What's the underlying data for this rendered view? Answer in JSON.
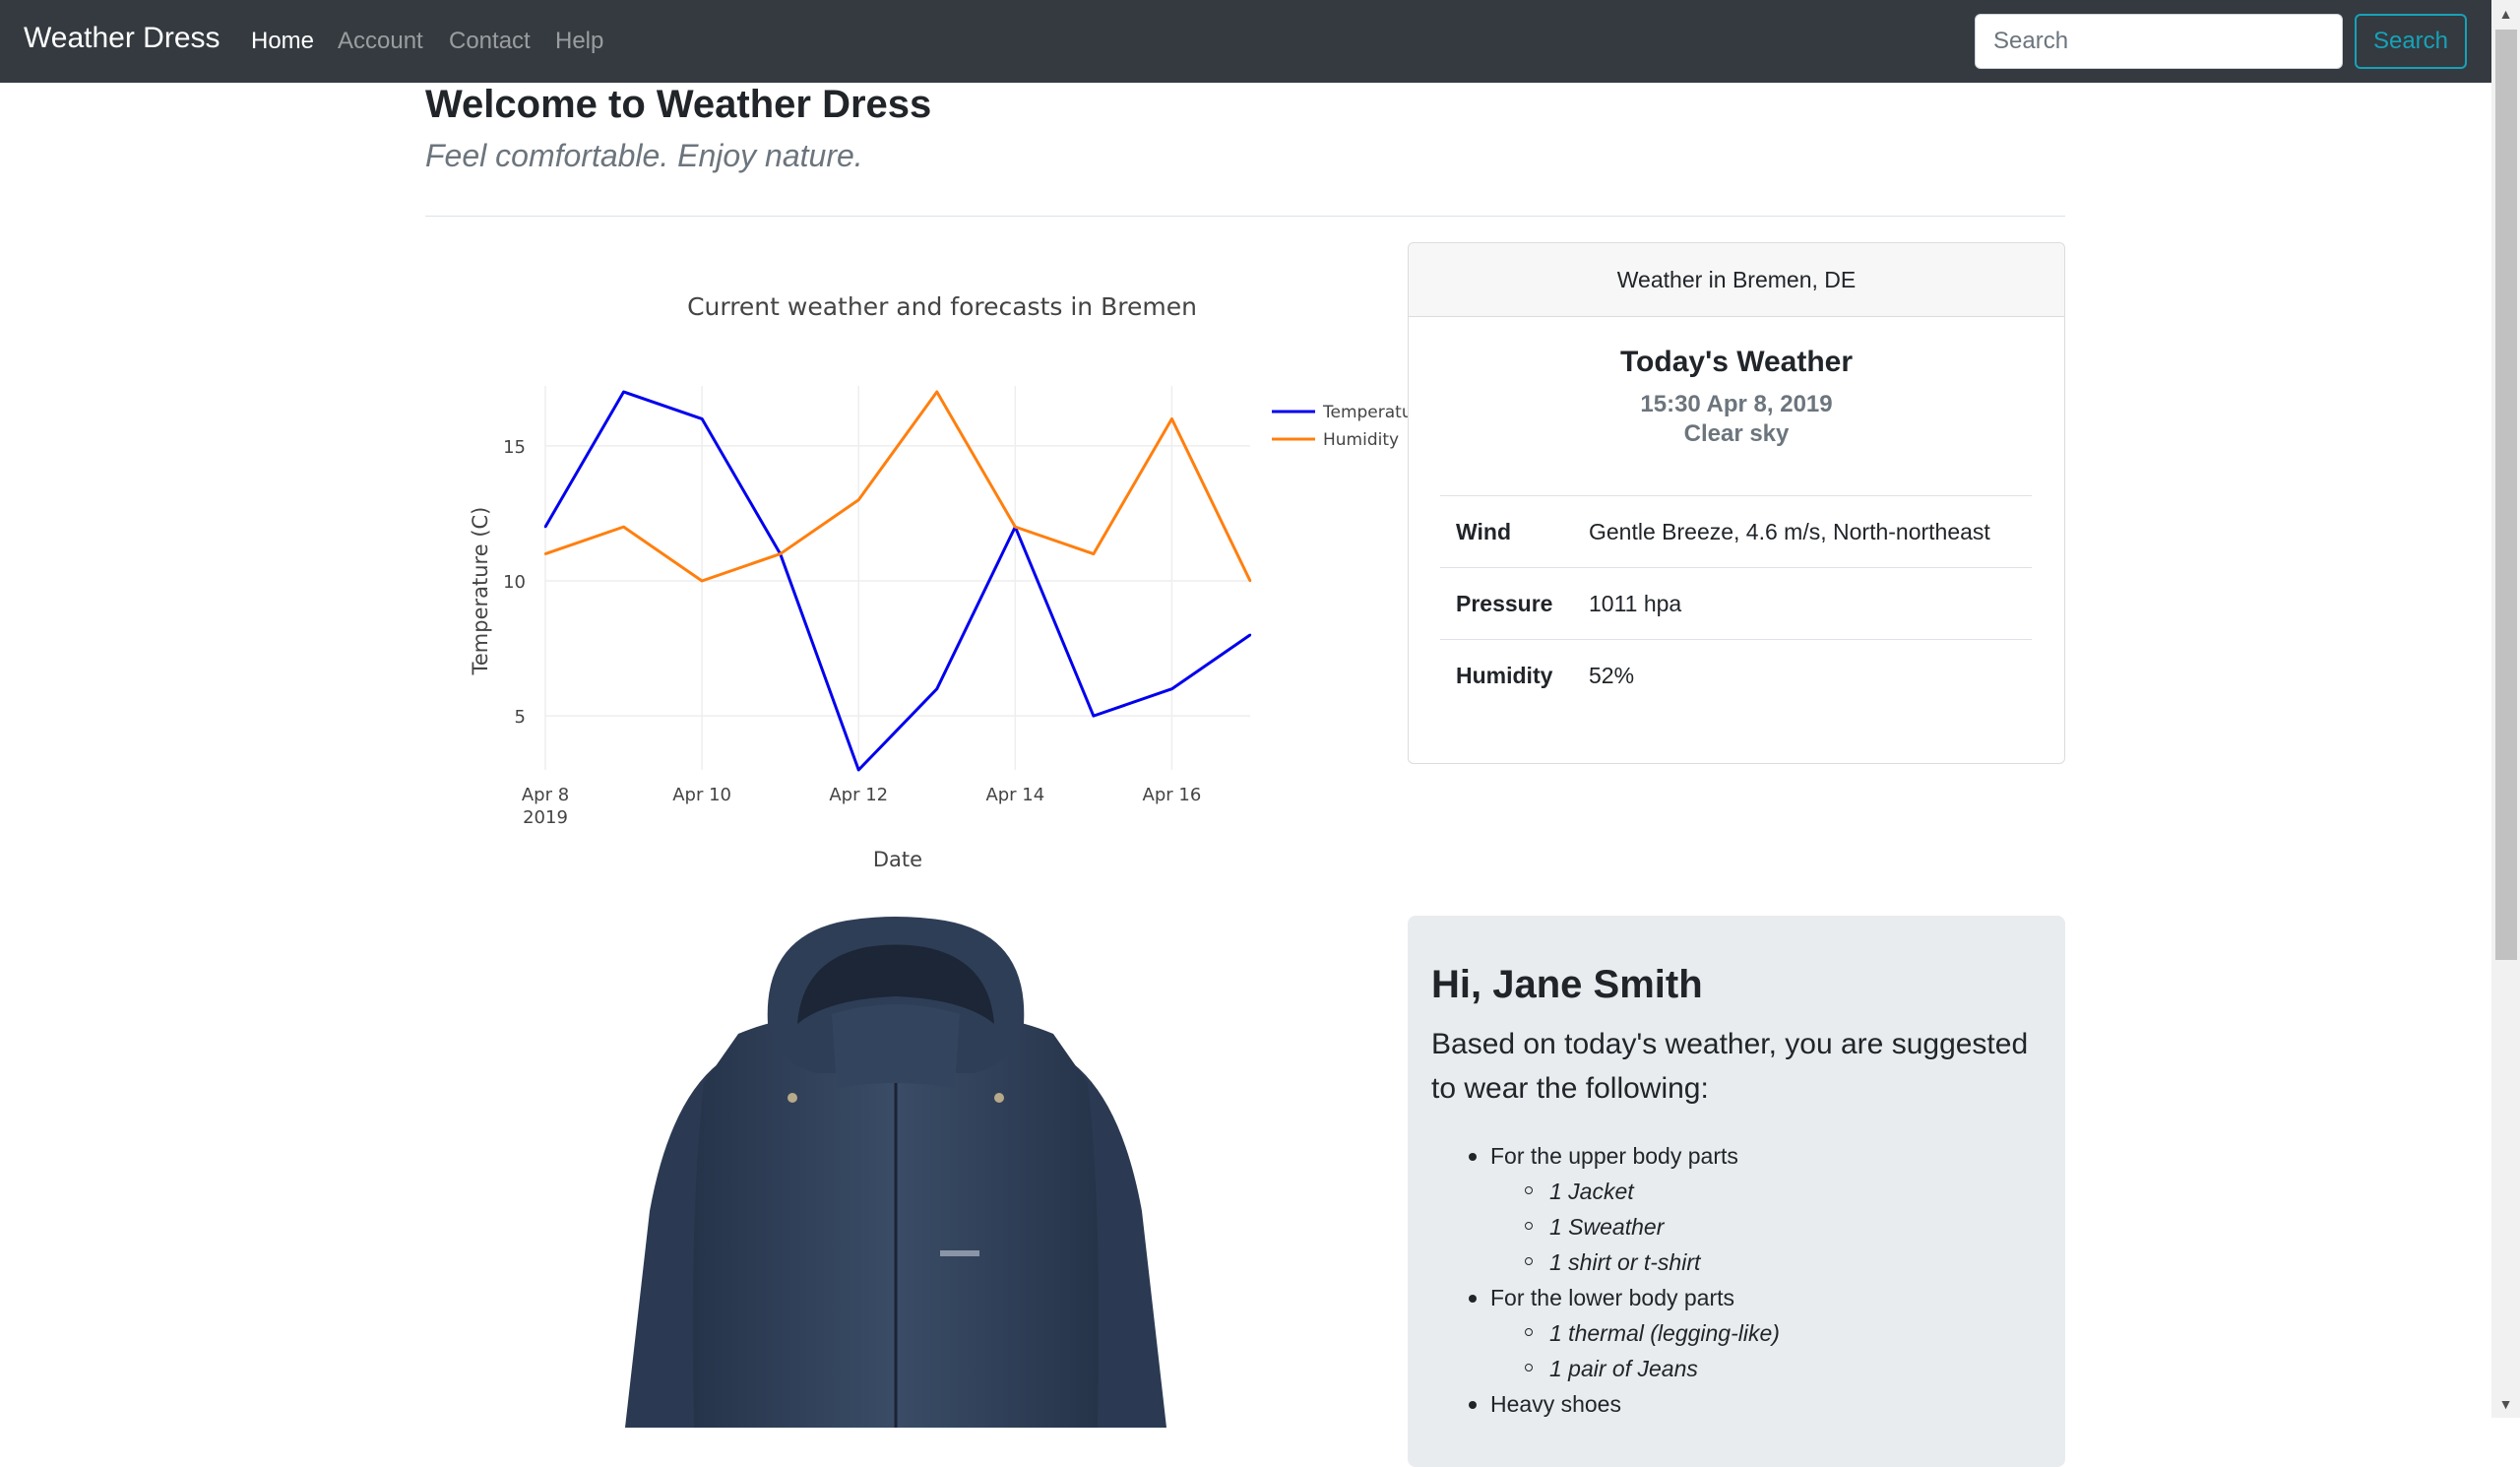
{
  "navbar": {
    "brand": "Weather Dress",
    "links": [
      "Home",
      "Account",
      "Contact",
      "Help"
    ],
    "active": "Home",
    "search_placeholder": "Search",
    "search_button": "Search"
  },
  "header": {
    "title": "Welcome to Weather Dress",
    "subtitle": "Feel comfortable. Enjoy nature."
  },
  "chart_data": {
    "type": "line",
    "title": "Current weather and forecasts in Bremen",
    "xlabel": "Date",
    "ylabel": "Temperature (C)",
    "x": [
      "2019-04-08",
      "2019-04-09",
      "2019-04-10",
      "2019-04-11",
      "2019-04-12",
      "2019-04-13",
      "2019-04-14",
      "2019-04-15",
      "2019-04-16",
      "2019-04-17"
    ],
    "x_tick_labels": [
      "Apr 8\n2019",
      "Apr 10",
      "Apr 12",
      "Apr 14",
      "Apr 16"
    ],
    "y_ticks": [
      5,
      10,
      15
    ],
    "ylim": [
      3,
      17
    ],
    "grid": true,
    "legend_position": "top-right",
    "series": [
      {
        "name": "Temperature",
        "color": "#0000ee",
        "values": [
          12,
          17,
          16,
          11,
          3,
          6,
          12,
          5,
          6,
          8
        ]
      },
      {
        "name": "Humidity",
        "color": "#ff7f0e",
        "values": [
          11,
          12,
          10,
          11,
          13,
          17,
          12,
          11,
          16,
          10
        ]
      }
    ],
    "legend_labels": [
      "Temperatu",
      "Humidity"
    ]
  },
  "weather_card": {
    "header": "Weather in Bremen, DE",
    "title": "Today's Weather",
    "time": "15:30 Apr 8, 2019",
    "condition": "Clear sky",
    "rows": [
      {
        "label": "Wind",
        "value": "Gentle Breeze, 4.6 m/s, North-northeast"
      },
      {
        "label": "Pressure",
        "value": "1011 hpa"
      },
      {
        "label": "Humidity",
        "value": "52%"
      }
    ]
  },
  "suggestion": {
    "greeting": "Hi, Jane Smith",
    "intro": "Based on today's weather, you are suggested to wear the following:",
    "upper_label": "For the upper body parts",
    "upper_items": [
      "1 Jacket",
      "1 Sweather",
      "1 shirt or t-shirt"
    ],
    "lower_label": "For the lower body parts",
    "lower_items": [
      "1 thermal (legging-like)",
      "1 pair of Jeans"
    ],
    "shoes": "Heavy shoes"
  },
  "image": {
    "icon": "jacket-image"
  },
  "colors": {
    "navbar": "#343a40",
    "accent": "#17a2b8",
    "temperature": "#0000ee",
    "humidity": "#ff7f0e"
  }
}
